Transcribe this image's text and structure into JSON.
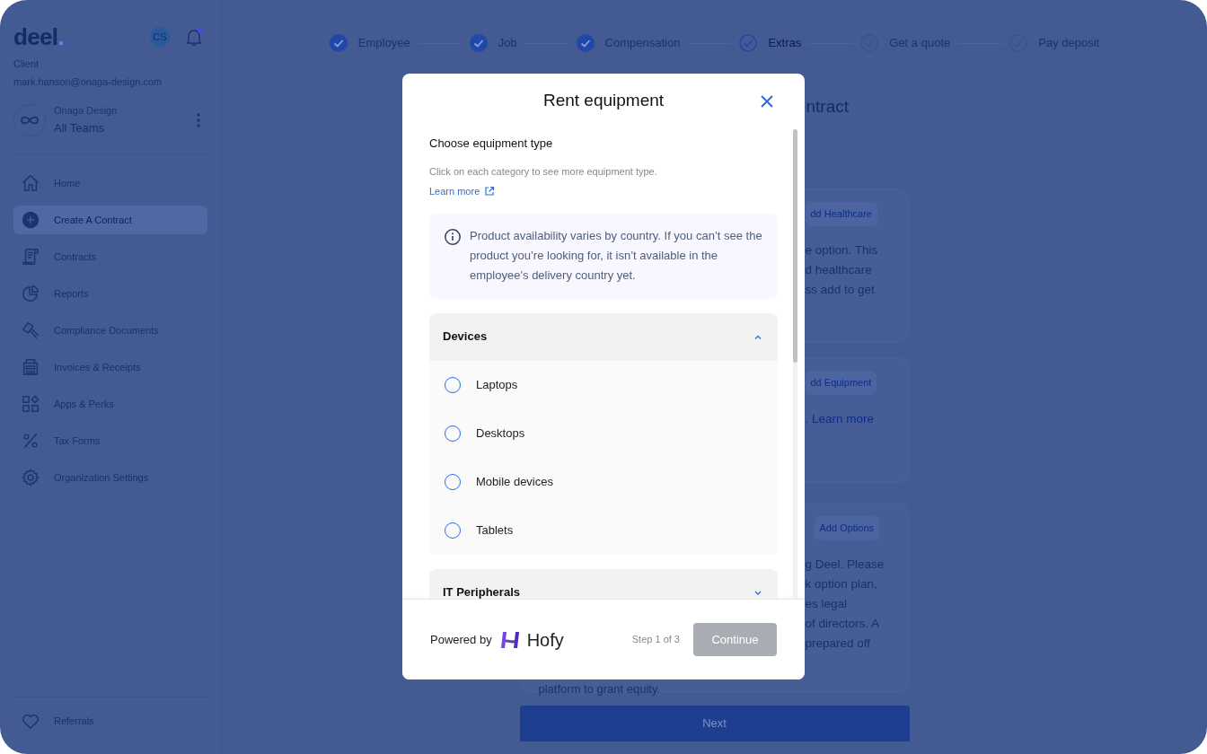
{
  "sidebar": {
    "logo": {
      "text": "deel",
      "mark": "."
    },
    "avatar": "CS",
    "notifications": true,
    "role": "Client",
    "email": "mark.hanson@onaga-design.com",
    "org": {
      "name": "Onaga Design",
      "team": "All Teams"
    },
    "items": [
      {
        "label": "Home",
        "selected": false
      },
      {
        "label": "Create A Contract",
        "selected": true
      },
      {
        "label": "Contracts",
        "selected": false
      },
      {
        "label": "Reports",
        "selected": false
      },
      {
        "label": "Compliance Documents",
        "selected": false
      },
      {
        "label": "Invoices & Receipts",
        "selected": false
      },
      {
        "label": "Apps & Perks",
        "selected": false
      },
      {
        "label": "Tax Forms",
        "selected": false
      },
      {
        "label": "Organization Settings",
        "selected": false
      }
    ],
    "footer_item": {
      "label": "Referrals"
    }
  },
  "steps": [
    {
      "label": "Employee",
      "done": true,
      "selected": false
    },
    {
      "label": "Job",
      "done": true,
      "selected": false
    },
    {
      "label": "Compensation",
      "done": true,
      "selected": false
    },
    {
      "label": "Extras",
      "done": false,
      "selected": true
    },
    {
      "label": "Get a quote",
      "done": false,
      "selected": false
    },
    {
      "label": "Pay deposit",
      "done": false,
      "selected": false
    }
  ],
  "page": {
    "title": "ntract",
    "cards": [
      {
        "button": "dd Healthcare",
        "lines": [
          "e option. This",
          "d healthcare",
          "ss add to get"
        ]
      },
      {
        "button": "dd Equipment",
        "lines": [
          ". Learn more"
        ]
      },
      {
        "button": "Add Options",
        "lines": [
          "g Deel. Please",
          "k option plan,",
          "es legal",
          "of directors. A",
          "prepared off"
        ]
      }
    ],
    "below_text": "platform to grant equity.",
    "next": "Next"
  },
  "modal": {
    "title": "Rent equipment",
    "heading": "Choose equipment type",
    "description": "Click on each category to see more equipment type.",
    "link": "Learn more",
    "notice": "Product availability varies by country. If you can’t see the product you’re looking for, it isn’t available in the employee’s delivery country yet.",
    "categories": [
      {
        "name": "Devices",
        "expanded": true,
        "options": [
          {
            "label": "Laptops",
            "selected": false
          },
          {
            "label": "Desktops",
            "selected": false
          },
          {
            "label": "Mobile devices",
            "selected": false
          },
          {
            "label": "Tablets",
            "selected": false
          }
        ]
      },
      {
        "name": "IT Peripherals",
        "expanded": false
      }
    ],
    "powered_by": "Powered by",
    "brand": "Hofy",
    "step": "Step 1 of 3",
    "continue": {
      "label": "Continue",
      "disabled": true
    }
  }
}
